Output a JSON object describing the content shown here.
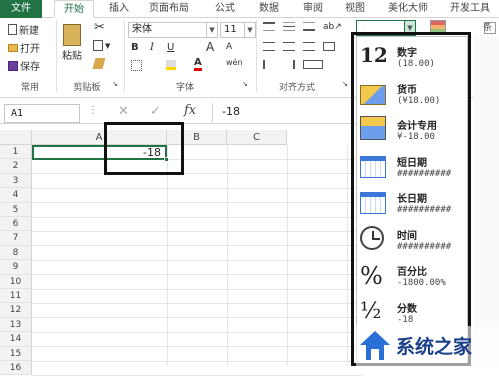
{
  "tabs": [
    "文件",
    "开始",
    "插入",
    "页面布局",
    "公式",
    "数据",
    "审阅",
    "视图",
    "美化大师",
    "开发工具"
  ],
  "quick": {
    "new_label": "新建",
    "open_label": "打开",
    "save_label": "保存",
    "group_label": "常用"
  },
  "clipboard": {
    "paste_label": "粘贴",
    "group_label": "剪贴板"
  },
  "font": {
    "family": "宋体",
    "size": "11",
    "bold": "B",
    "italic": "I",
    "underline": "U",
    "grow": "A",
    "shrink": "A",
    "wen": "wén",
    "group_label": "字体"
  },
  "alignment": {
    "group_label": "对齐方式"
  },
  "formula_bar": {
    "name_box": "A1",
    "cancel": "✕",
    "enter": "✓",
    "fx": "fx",
    "content": "-18"
  },
  "columns": [
    "A",
    "B",
    "C"
  ],
  "rows": [
    "1",
    "2",
    "3",
    "4",
    "5",
    "6",
    "7",
    "8",
    "9",
    "10",
    "11",
    "12",
    "13",
    "14",
    "15",
    "16"
  ],
  "cell_a1": "-18",
  "number_format_menu": [
    {
      "name": "数字",
      "sample": "(18.00)",
      "icon": "number-12-icon",
      "icon_text": "12"
    },
    {
      "name": "货币",
      "sample": "(¥18.00)",
      "icon": "currency-icon",
      "icon_text": ""
    },
    {
      "name": "会计专用",
      "sample": "¥-18.00",
      "icon": "accounting-icon",
      "icon_text": ""
    },
    {
      "name": "短日期",
      "sample": "##########",
      "icon": "short-date-icon",
      "icon_text": ""
    },
    {
      "name": "长日期",
      "sample": "##########",
      "icon": "long-date-icon",
      "icon_text": ""
    },
    {
      "name": "时间",
      "sample": "##########",
      "icon": "clock-icon",
      "icon_text": ""
    },
    {
      "name": "百分比",
      "sample": "-1800.00%",
      "icon": "percent-icon",
      "icon_text": "%"
    },
    {
      "name": "分数",
      "sample": "-18",
      "icon": "fraction-icon",
      "icon_text": "½"
    }
  ],
  "watermark": {
    "text": "系统之家"
  },
  "colors": {
    "accent": "#217346",
    "grid": "#e4e4e4",
    "header_bg": "#f3f3f3"
  }
}
